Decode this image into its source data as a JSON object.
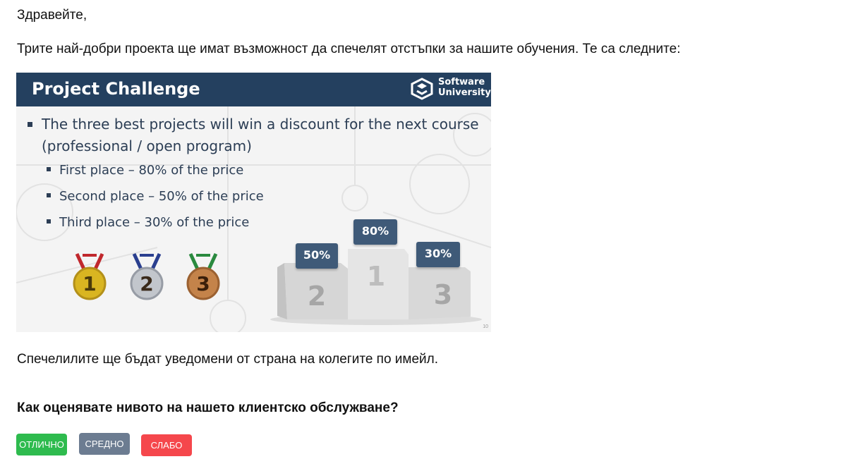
{
  "email": {
    "greeting": "Здравейте,",
    "intro": "Трите най-добри проекта ще имат възможност да спечелят отстъпки за нашите обучения. Те са следните:",
    "winners_note": "Спечелилите ще бъдат уведомени от страна на колегите по имейл.",
    "rating_question": "Как оценявате нивото на нашето клиентско обслужване?"
  },
  "slide": {
    "title": "Project Challenge",
    "logo_line1": "Software",
    "logo_line2": "University",
    "main_bullet": "The three best projects will win a discount for the next course (professional / open program)",
    "sub_bullets": [
      "First place – 80% of the price",
      "Second place – 50% of the price",
      "Third place – 30% of the price"
    ],
    "medals": [
      "1",
      "2",
      "3"
    ],
    "podium_numbers": [
      "1",
      "2",
      "3"
    ],
    "podium_labels": {
      "first": "80%",
      "second": "50%",
      "third": "30%"
    },
    "slide_number": "10",
    "colors": {
      "header": "#24405f",
      "text": "#2c3e55",
      "badge": "#3f5a78"
    }
  },
  "rating_buttons": [
    {
      "label": "ОТЛИЧНО",
      "color": "#2ebb4e"
    },
    {
      "label": "СРЕДНО",
      "color": "#6c7c91"
    },
    {
      "label": "СЛАБО",
      "color": "#f5474c"
    }
  ]
}
